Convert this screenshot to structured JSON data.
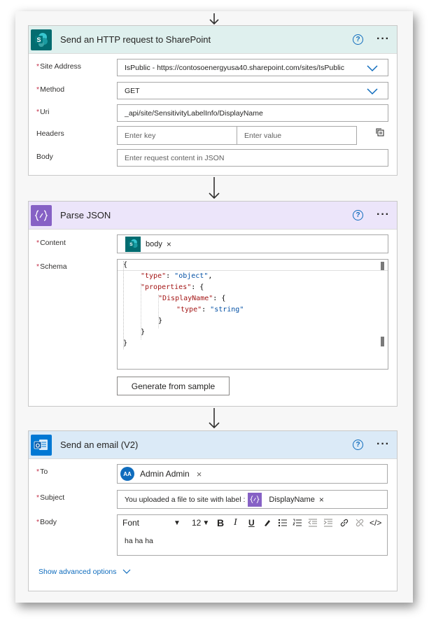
{
  "card_http": {
    "title": "Send an HTTP request to SharePoint",
    "help_icon": "help-circle-icon",
    "more_label": "···",
    "fields": {
      "site_address_label": "Site Address",
      "site_address_value": "IsPublic - https://contosoenergyusa40.sharepoint.com/sites/IsPublic",
      "method_label": "Method",
      "method_value": "GET",
      "uri_label": "Uri",
      "uri_value": "_api/site/SensitivityLabelInfo/DisplayName",
      "headers_label": "Headers",
      "headers_key_placeholder": "Enter key",
      "headers_value_placeholder": "Enter value",
      "body_label": "Body",
      "body_placeholder": "Enter request content in JSON"
    },
    "required_marker": "*"
  },
  "card_parse": {
    "title": "Parse JSON",
    "more_label": "···",
    "content_label": "Content",
    "content_token": "body",
    "token_remove": "×",
    "schema_label": "Schema",
    "schema_lines": {
      "l1": "{",
      "l2_key": "\"type\"",
      "l2_val": "\"object\"",
      "l3_key": "\"properties\"",
      "l4_key": "\"DisplayName\"",
      "l5_key": "\"type\"",
      "l5_val": "\"string\"",
      "l6": "}",
      "l7": "}",
      "l8": "}"
    },
    "generate_button": "Generate from sample"
  },
  "card_email": {
    "title": "Send an email (V2)",
    "more_label": "···",
    "to_label": "To",
    "to_avatar": "AA",
    "to_name": "Admin Admin",
    "to_remove": "×",
    "subject_label": "Subject",
    "subject_text": "You uploaded a file to site with label :",
    "subject_token": "DisplayName",
    "subject_token_remove": "×",
    "body_label": "Body",
    "font_select": "Font",
    "font_size": "12",
    "bold": "B",
    "italic": "I",
    "underline": "U",
    "code_view": "</>",
    "body_text": "ha ha ha",
    "advanced_link": "Show advanced options"
  },
  "colors": {
    "sharepoint_teal": "#036c70",
    "parse_purple": "#8661c5",
    "outlook_blue": "#0078d4",
    "http_header_bg": "#dff0ee",
    "parse_header_bg": "#ece5fa",
    "email_header_bg": "#dbeaf7",
    "required": "#c4314b",
    "link": "#0f6cbd"
  }
}
